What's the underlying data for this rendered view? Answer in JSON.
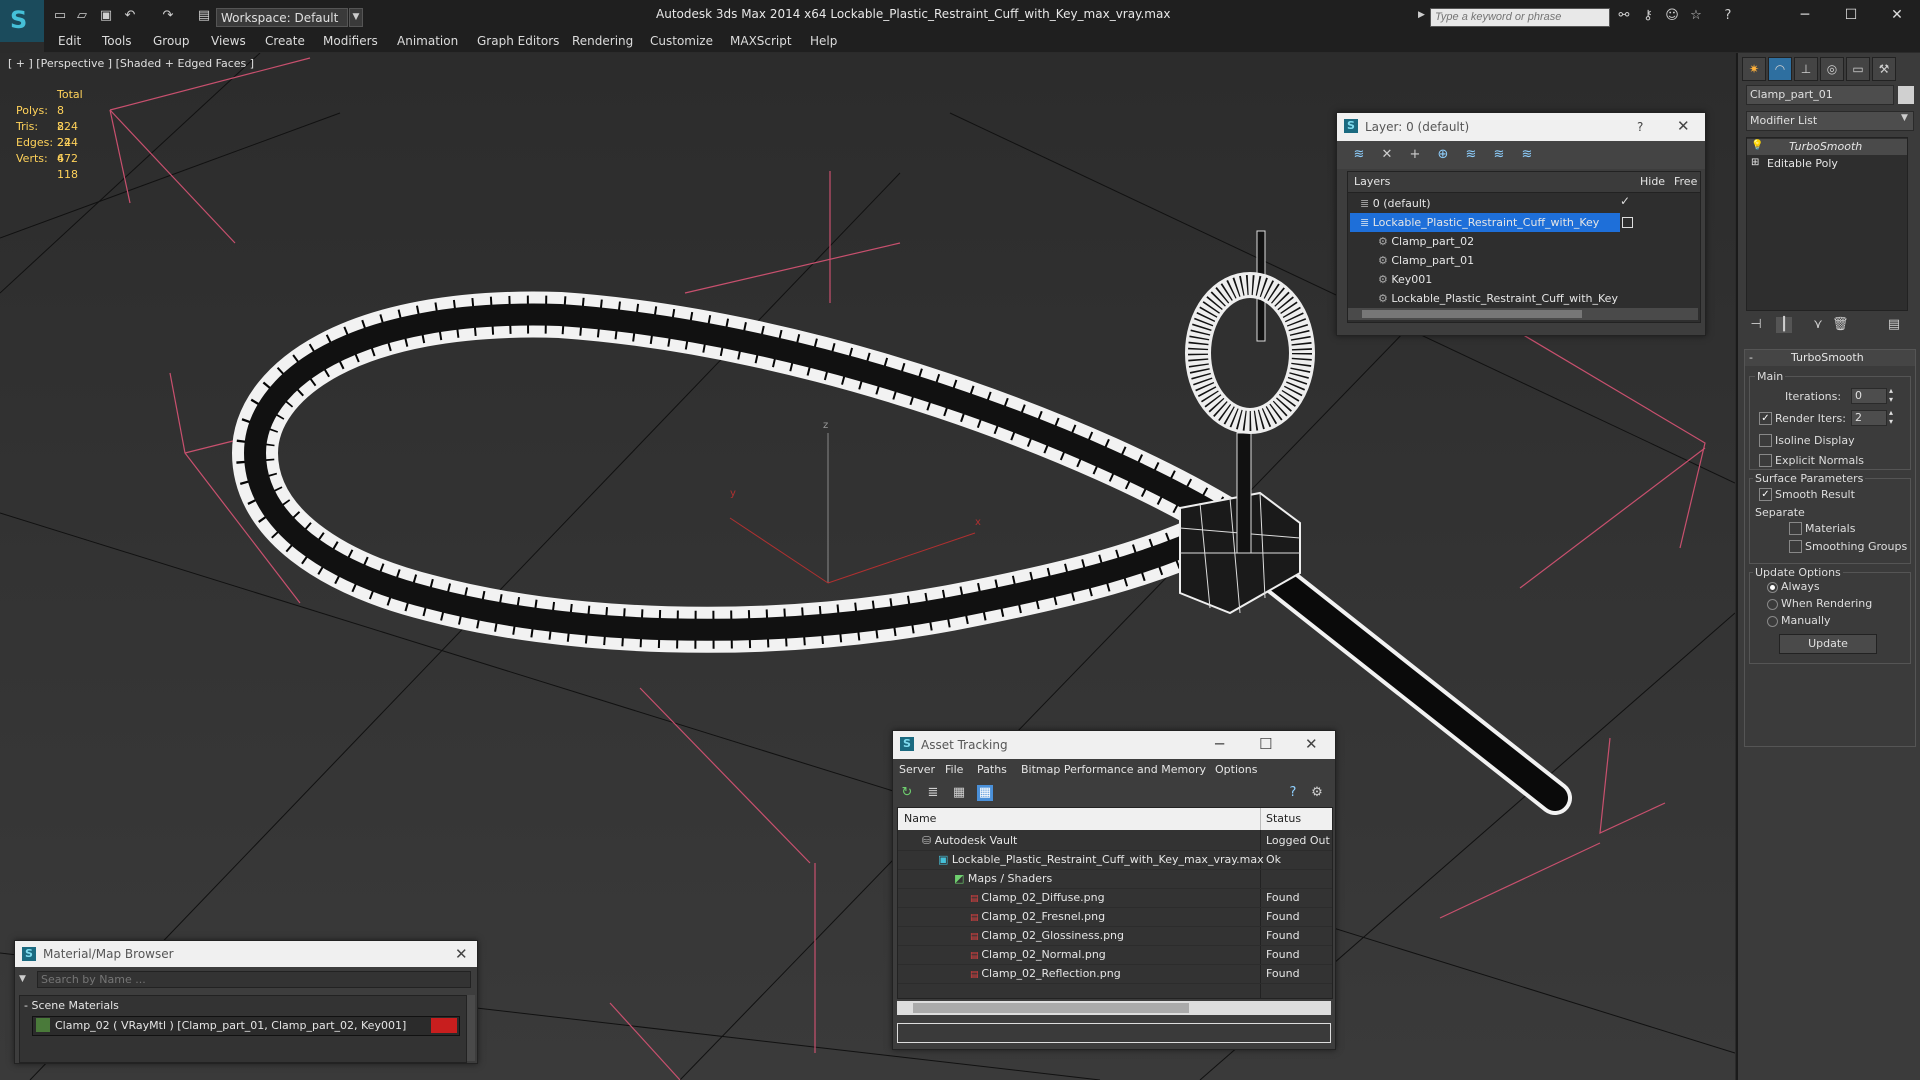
{
  "titlebar": {
    "workspace": "Workspace: Default",
    "title": "Autodesk 3ds Max  2014 x64       Lockable_Plastic_Restraint_Cuff_with_Key_max_vray.max",
    "search_placeholder": "Type a keyword or phrase"
  },
  "menu": [
    "Edit",
    "Tools",
    "Group",
    "Views",
    "Create",
    "Modifiers",
    "Animation",
    "Graph Editors",
    "Rendering",
    "Customize",
    "MAXScript",
    "Help"
  ],
  "viewport": {
    "label": "[ + ] [Perspective ] [Shaded + Edged Faces ]",
    "stats": {
      "header": "Total",
      "rows": [
        {
          "label": "Polys:",
          "value": "8 224"
        },
        {
          "label": "Tris:",
          "value": "8 224"
        },
        {
          "label": "Edges:",
          "value": "24 672"
        },
        {
          "label": "Verts:",
          "value": "4 118"
        }
      ]
    },
    "axes": {
      "x": "x",
      "y": "y",
      "z": "z"
    }
  },
  "layer_dialog": {
    "title": "Layer: 0 (default)",
    "help": "?",
    "columns": {
      "layers": "Layers",
      "hide": "Hide",
      "freeze": "Free"
    },
    "rows": [
      {
        "label": "0 (default)",
        "indent": 0
      },
      {
        "label": "Lockable_Plastic_Restraint_Cuff_with_Key",
        "indent": 0,
        "selected": true
      },
      {
        "label": "Clamp_part_02",
        "indent": 1
      },
      {
        "label": "Clamp_part_01",
        "indent": 1
      },
      {
        "label": "Key001",
        "indent": 1
      },
      {
        "label": "Lockable_Plastic_Restraint_Cuff_with_Key",
        "indent": 1
      }
    ]
  },
  "asset_tracking": {
    "title": "Asset Tracking",
    "menu": [
      "Server",
      "File",
      "Paths",
      "Bitmap Performance and Memory",
      "Options"
    ],
    "columns": {
      "name": "Name",
      "status": "Status"
    },
    "rows": [
      {
        "name": "Autodesk Vault",
        "status": "Logged Out",
        "indent": 0,
        "icon": "vault-icon"
      },
      {
        "name": "Lockable_Plastic_Restraint_Cuff_with_Key_max_vray.max",
        "status": "Ok",
        "indent": 1,
        "icon": "max-file-icon"
      },
      {
        "name": "Maps / Shaders",
        "status": "",
        "indent": 2,
        "icon": "maps-icon"
      },
      {
        "name": "Clamp_02_Diffuse.png",
        "status": "Found",
        "indent": 3,
        "icon": "png-icon"
      },
      {
        "name": "Clamp_02_Fresnel.png",
        "status": "Found",
        "indent": 3,
        "icon": "png-icon"
      },
      {
        "name": "Clamp_02_Glossiness.png",
        "status": "Found",
        "indent": 3,
        "icon": "png-icon"
      },
      {
        "name": "Clamp_02_Normal.png",
        "status": "Found",
        "indent": 3,
        "icon": "png-icon"
      },
      {
        "name": "Clamp_02_Reflection.png",
        "status": "Found",
        "indent": 3,
        "icon": "png-icon"
      }
    ]
  },
  "material_browser": {
    "title": "Material/Map Browser",
    "search_placeholder": "Search by Name ...",
    "section": "- Scene Materials",
    "item": "Clamp_02  ( VRayMtl )  [Clamp_part_01, Clamp_part_02, Key001]"
  },
  "command_panel": {
    "object_name": "Clamp_part_01",
    "modifier_list": "Modifier List",
    "stack": [
      "TurboSmooth",
      "Editable Poly"
    ],
    "rollout_title": "TurboSmooth",
    "main": "Main",
    "iterations_label": "Iterations:",
    "iterations_value": "0",
    "render_iters_label": "Render Iters:",
    "render_iters_value": "2",
    "isoline": "Isoline Display",
    "explicit_normals": "Explicit Normals",
    "surface_params": "Surface Parameters",
    "smooth_result": "Smooth Result",
    "separate": "Separate",
    "materials": "Materials",
    "smoothing_groups": "Smoothing Groups",
    "update_options": "Update Options",
    "always": "Always",
    "when_rendering": "When Rendering",
    "manually": "Manually",
    "update": "Update"
  },
  "colors": {
    "accent": "#3a7bd5",
    "stats": "#ffd25a",
    "grid": "#d04a6a",
    "selection": "#1e6fd9"
  }
}
